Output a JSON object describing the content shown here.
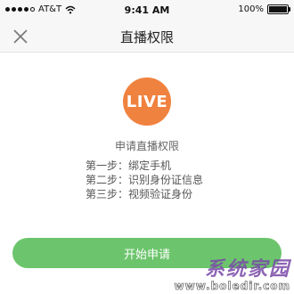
{
  "status_bar": {
    "carrier": "AT&T",
    "time": "9:41 AM",
    "battery": "100%"
  },
  "nav": {
    "title": "直播权限",
    "close_icon": "close-icon"
  },
  "badge": {
    "label": "LIVE",
    "color": "#f0823f"
  },
  "request": {
    "title": "申请直播权限",
    "steps": [
      "第一步：绑定手机",
      "第二步：识别身份证信息",
      "第三步：视频验证身份"
    ]
  },
  "action": {
    "start_label": "开始申请",
    "color": "#6cc56c"
  },
  "watermark": {
    "text": "系统家园",
    "url": "www.boledir.com"
  }
}
